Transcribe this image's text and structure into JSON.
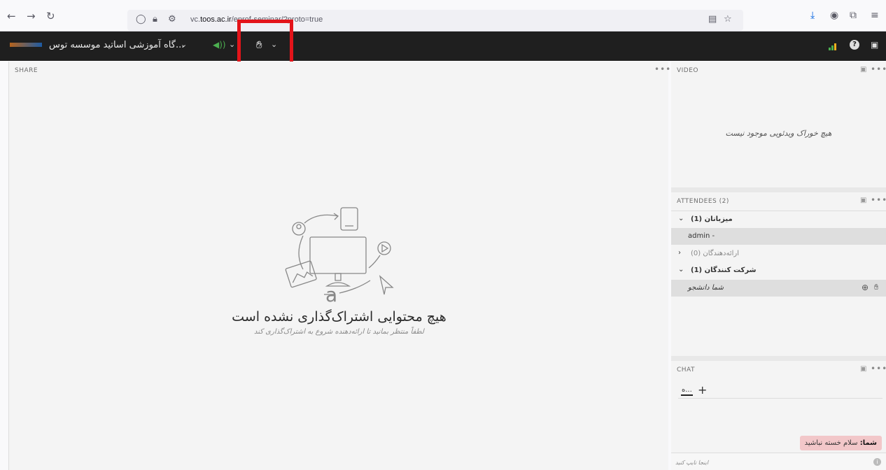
{
  "browser": {
    "url_prefix": "vc.",
    "url_domain": "toos.ac.ir",
    "url_path": "/eprof-seminar/?proto=true"
  },
  "app": {
    "room_name": "...گاه آموزشی اساتید موسسه توس",
    "accent_color": "#4caf50",
    "highlight_color": "#e3141a"
  },
  "share": {
    "title": "SHARE",
    "empty_title": "هیچ محتوایی اشتراک‌گذاری نشده است",
    "empty_subtitle": "لطفاً منتظر بمانید تا ارائه‌دهنده شروع به اشتراک‌گذاری کند"
  },
  "video": {
    "title": "VIDEO",
    "empty_message": "هیچ خوراک ویدئویی موجود نیست"
  },
  "attendees": {
    "title": "ATTENDEES  (2)",
    "groups": [
      {
        "label": "میزبانان (1)",
        "expanded": true
      },
      {
        "label": "ارائه‌دهندگان (0)",
        "expanded": false
      },
      {
        "label": "شرکت کنندگان (1)",
        "expanded": true
      }
    ],
    "host_user": "admin -",
    "participant_user": "شما دانشجو"
  },
  "chat": {
    "title": "CHAT",
    "tab_label": "ه...",
    "message_sender": "شما:",
    "message_text": " سلام خسته نباشید",
    "input_placeholder": "اینجا تایپ کنید"
  }
}
